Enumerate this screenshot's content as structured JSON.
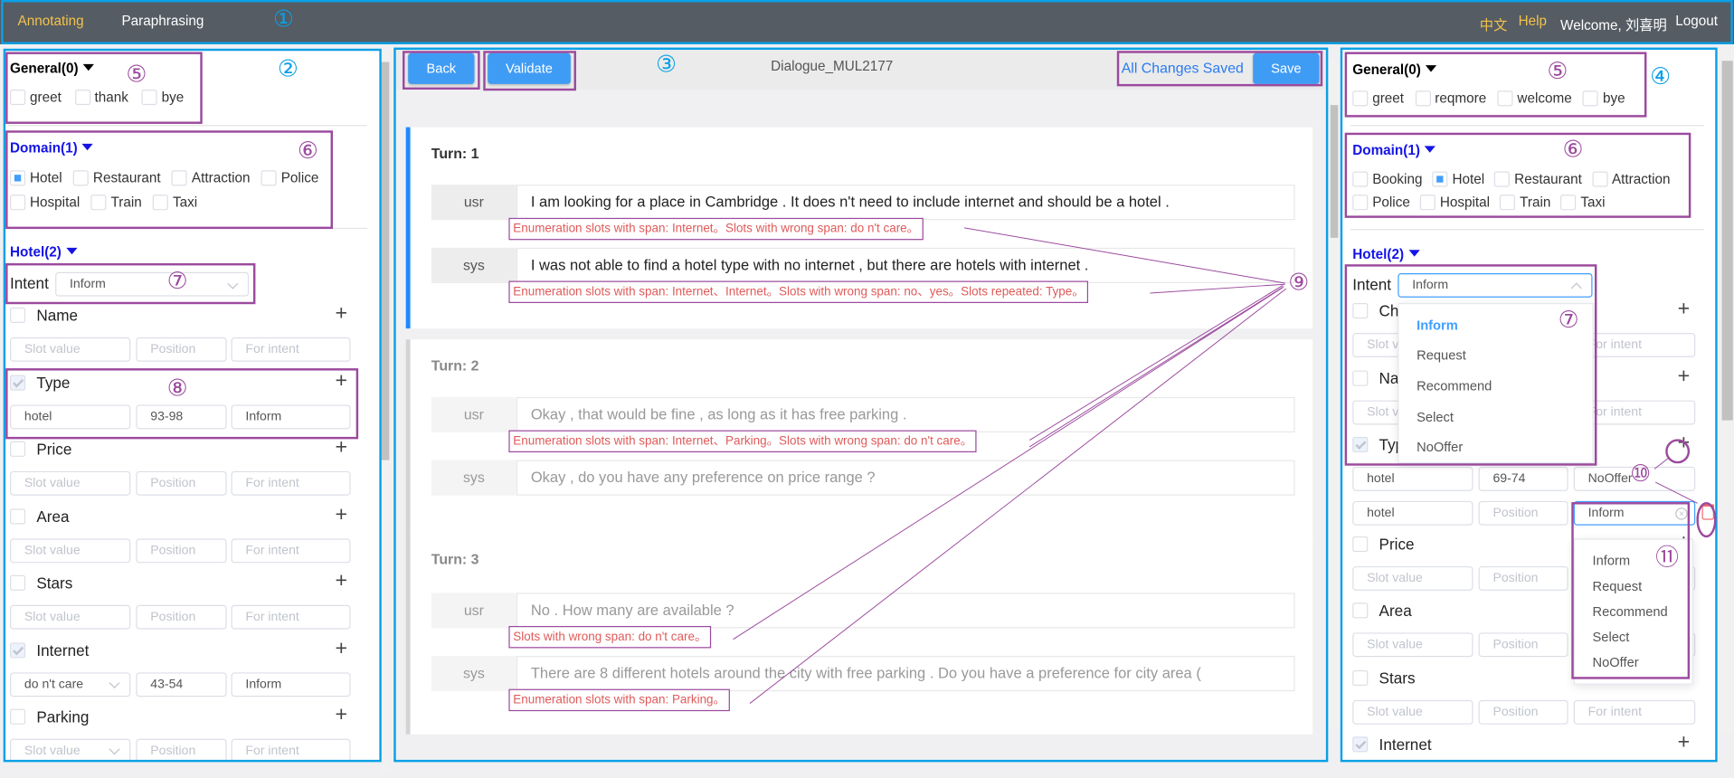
{
  "nav": {
    "tabs": [
      "Annotating",
      "Paraphrasing"
    ],
    "active_tab": "Annotating",
    "language": "中文",
    "help": "Help",
    "welcome": "Welcome, 刘喜明",
    "logout": "Logout"
  },
  "annotations": {
    "n1": "①",
    "n2": "②",
    "n3": "③",
    "n4": "④",
    "n5": "⑤",
    "n6": "⑥",
    "n7": "⑦",
    "n8": "⑧",
    "n9": "⑨",
    "n10": "⑩",
    "n11": "⑪"
  },
  "colors": {
    "annotation_blue": "#0aa0e6",
    "annotation_purple": "#9b4a9e",
    "primary": "#3f9cf5",
    "error_text": "#e05a5a",
    "domain_blue": "#1414e6",
    "nav_active": "#f3c24a",
    "nav_bg": "#555c64"
  },
  "placeholders": {
    "value": "Slot value",
    "position": "Position",
    "intent": "For intent"
  },
  "left": {
    "general": {
      "title": "General(0)",
      "items": [
        {
          "label": "greet",
          "state": "none"
        },
        {
          "label": "thank",
          "state": "none"
        },
        {
          "label": "bye",
          "state": "none"
        }
      ]
    },
    "domain": {
      "title": "Domain(1)",
      "rows": [
        [
          {
            "label": "Hotel",
            "state": "selected"
          },
          {
            "label": "Restaurant",
            "state": "none"
          },
          {
            "label": "Attraction",
            "state": "none"
          },
          {
            "label": "Police",
            "state": "none"
          }
        ],
        [
          {
            "label": "Hospital",
            "state": "none"
          },
          {
            "label": "Train",
            "state": "none"
          },
          {
            "label": "Taxi",
            "state": "none"
          }
        ]
      ]
    },
    "hotel": {
      "title": "Hotel(2)",
      "intent_label": "Intent",
      "intent_value": "Inform"
    },
    "slots": [
      {
        "name": "Name",
        "checked": false,
        "rows": [
          {
            "value": "",
            "position": "",
            "intent": ""
          }
        ]
      },
      {
        "name": "Type",
        "checked": true,
        "rows": [
          {
            "value": "hotel",
            "position": "93-98",
            "intent": "Inform"
          }
        ]
      },
      {
        "name": "Price",
        "checked": false,
        "rows": [
          {
            "value": "",
            "position": "",
            "intent": ""
          }
        ]
      },
      {
        "name": "Area",
        "checked": false,
        "rows": [
          {
            "value": "",
            "position": "",
            "intent": ""
          }
        ]
      },
      {
        "name": "Stars",
        "checked": false,
        "rows": [
          {
            "value": "",
            "position": "",
            "intent": ""
          }
        ]
      },
      {
        "name": "Internet",
        "checked": true,
        "rows": [
          {
            "value": "do n't care",
            "value_is_select": true,
            "position": "43-54",
            "intent": "Inform"
          }
        ]
      },
      {
        "name": "Parking",
        "checked": false,
        "rows": [
          {
            "value": "",
            "value_is_select": true,
            "position": "",
            "intent": ""
          }
        ]
      }
    ]
  },
  "center": {
    "back": "Back",
    "validate": "Validate",
    "dialogue_id": "Dialogue_MUL2177",
    "save_status": "All Changes Saved",
    "save": "Save",
    "turns": [
      {
        "label": "Turn: 1",
        "active": true,
        "utterances": [
          {
            "speaker": "usr",
            "text": "I am looking for a place in Cambridge . It does n't need to include internet and should be a hotel .",
            "error": "Enumeration slots with span: Internet。Slots with wrong span: do n't care。"
          },
          {
            "speaker": "sys",
            "text": "I was not able to find a hotel type with no internet , but there are hotels with internet .",
            "error": "Enumeration slots with span: Internet、Internet。Slots with wrong span: no、yes。Slots repeated: Type。"
          }
        ]
      },
      {
        "label": "Turn: 2",
        "active": false,
        "utterances": [
          {
            "speaker": "usr",
            "text": "Okay , that would be fine , as long as it has free parking .",
            "error": "Enumeration slots with span: Internet、Parking。Slots with wrong span: do n't care。"
          },
          {
            "speaker": "sys",
            "text": "Okay , do you have any preference on price range ?",
            "error": ""
          }
        ]
      },
      {
        "label": "Turn: 3",
        "active": false,
        "utterances": [
          {
            "speaker": "usr",
            "text": "No . How many are available ?",
            "error": "Slots with wrong span: do n't care。"
          },
          {
            "speaker": "sys",
            "text": "There are 8 different hotels around the city with free parking . Do you have a preference for city area (",
            "error": "Enumeration slots with span: Parking。"
          }
        ]
      }
    ]
  },
  "right": {
    "general": {
      "title": "General(0)",
      "items": [
        {
          "label": "greet",
          "state": "none"
        },
        {
          "label": "reqmore",
          "state": "none"
        },
        {
          "label": "welcome",
          "state": "none"
        },
        {
          "label": "bye",
          "state": "none"
        }
      ]
    },
    "domain": {
      "title": "Domain(1)",
      "rows": [
        [
          {
            "label": "Booking",
            "state": "none"
          },
          {
            "label": "Hotel",
            "state": "selected"
          },
          {
            "label": "Restaurant",
            "state": "none"
          },
          {
            "label": "Attraction",
            "state": "none"
          }
        ],
        [
          {
            "label": "Police",
            "state": "none"
          },
          {
            "label": "Hospital",
            "state": "none"
          },
          {
            "label": "Train",
            "state": "none"
          },
          {
            "label": "Taxi",
            "state": "none"
          }
        ]
      ]
    },
    "hotel": {
      "title": "Hotel(2)",
      "intent_label": "Intent",
      "intent_value": "Inform"
    },
    "intent_options": [
      "Inform",
      "Request",
      "Recommend",
      "Select",
      "NoOffer"
    ],
    "intent_selected": "Inform",
    "slots": [
      {
        "name": "Ch",
        "checked": false,
        "rows": [
          {
            "value": "",
            "position": "",
            "intent": ""
          }
        ]
      },
      {
        "name": "Name",
        "checked": false,
        "rows": [
          {
            "value": "",
            "position": "",
            "intent": ""
          }
        ]
      },
      {
        "name": "Type",
        "checked": true,
        "rows": [
          {
            "value": "hotel",
            "position": "69-74",
            "intent": "NoOffer"
          },
          {
            "value": "hotel",
            "position": "",
            "intent": "Inform",
            "intent_focused": true,
            "deletable": true
          }
        ]
      },
      {
        "name": "Price",
        "checked": false,
        "rows": [
          {
            "value": "",
            "position": "",
            "intent": ""
          }
        ]
      },
      {
        "name": "Area",
        "checked": false,
        "rows": [
          {
            "value": "",
            "position": "",
            "intent": ""
          }
        ]
      },
      {
        "name": "Stars",
        "checked": false,
        "rows": [
          {
            "value": "",
            "position": "",
            "intent": ""
          }
        ]
      },
      {
        "name": "Internet",
        "checked": true,
        "rows": [
          {
            "value": "",
            "position": "",
            "intent": ""
          }
        ]
      }
    ],
    "slot_intent_options": [
      "Inform",
      "Request",
      "Recommend",
      "Select",
      "NoOffer"
    ]
  }
}
